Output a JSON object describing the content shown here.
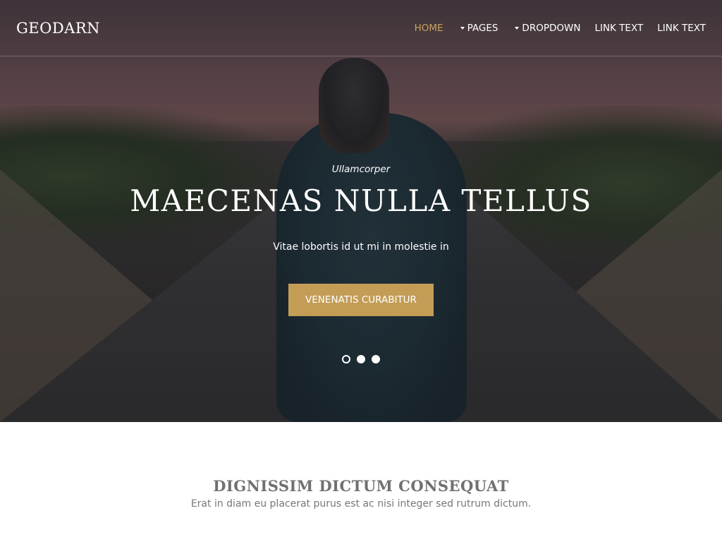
{
  "header": {
    "logo": "GEODARN",
    "nav": [
      {
        "label": "HOME",
        "active": true,
        "dropdown": false
      },
      {
        "label": "PAGES",
        "active": false,
        "dropdown": true
      },
      {
        "label": "DROPDOWN",
        "active": false,
        "dropdown": true
      },
      {
        "label": "LINK TEXT",
        "active": false,
        "dropdown": false
      },
      {
        "label": "LINK TEXT",
        "active": false,
        "dropdown": false
      }
    ]
  },
  "hero": {
    "eyebrow": "Ullamcorper",
    "headline": "MAECENAS NULLA TELLUS",
    "subtext": "Vitae lobortis id ut mi in molestie in",
    "cta_label": "VENENATIS CURABITUR",
    "slides": {
      "count": 3,
      "active_index": 0
    }
  },
  "section": {
    "title": "DIGNISSIM DICTUM CONSEQUAT",
    "subtitle": "Erat in diam eu placerat purus est ac nisi integer sed rutrum dictum."
  },
  "colors": {
    "accent": "#c39d56",
    "active_nav": "#c9a45d",
    "section_title": "#707070",
    "section_text": "#777777"
  },
  "icons": {
    "dropdown": "caret-down-icon"
  }
}
